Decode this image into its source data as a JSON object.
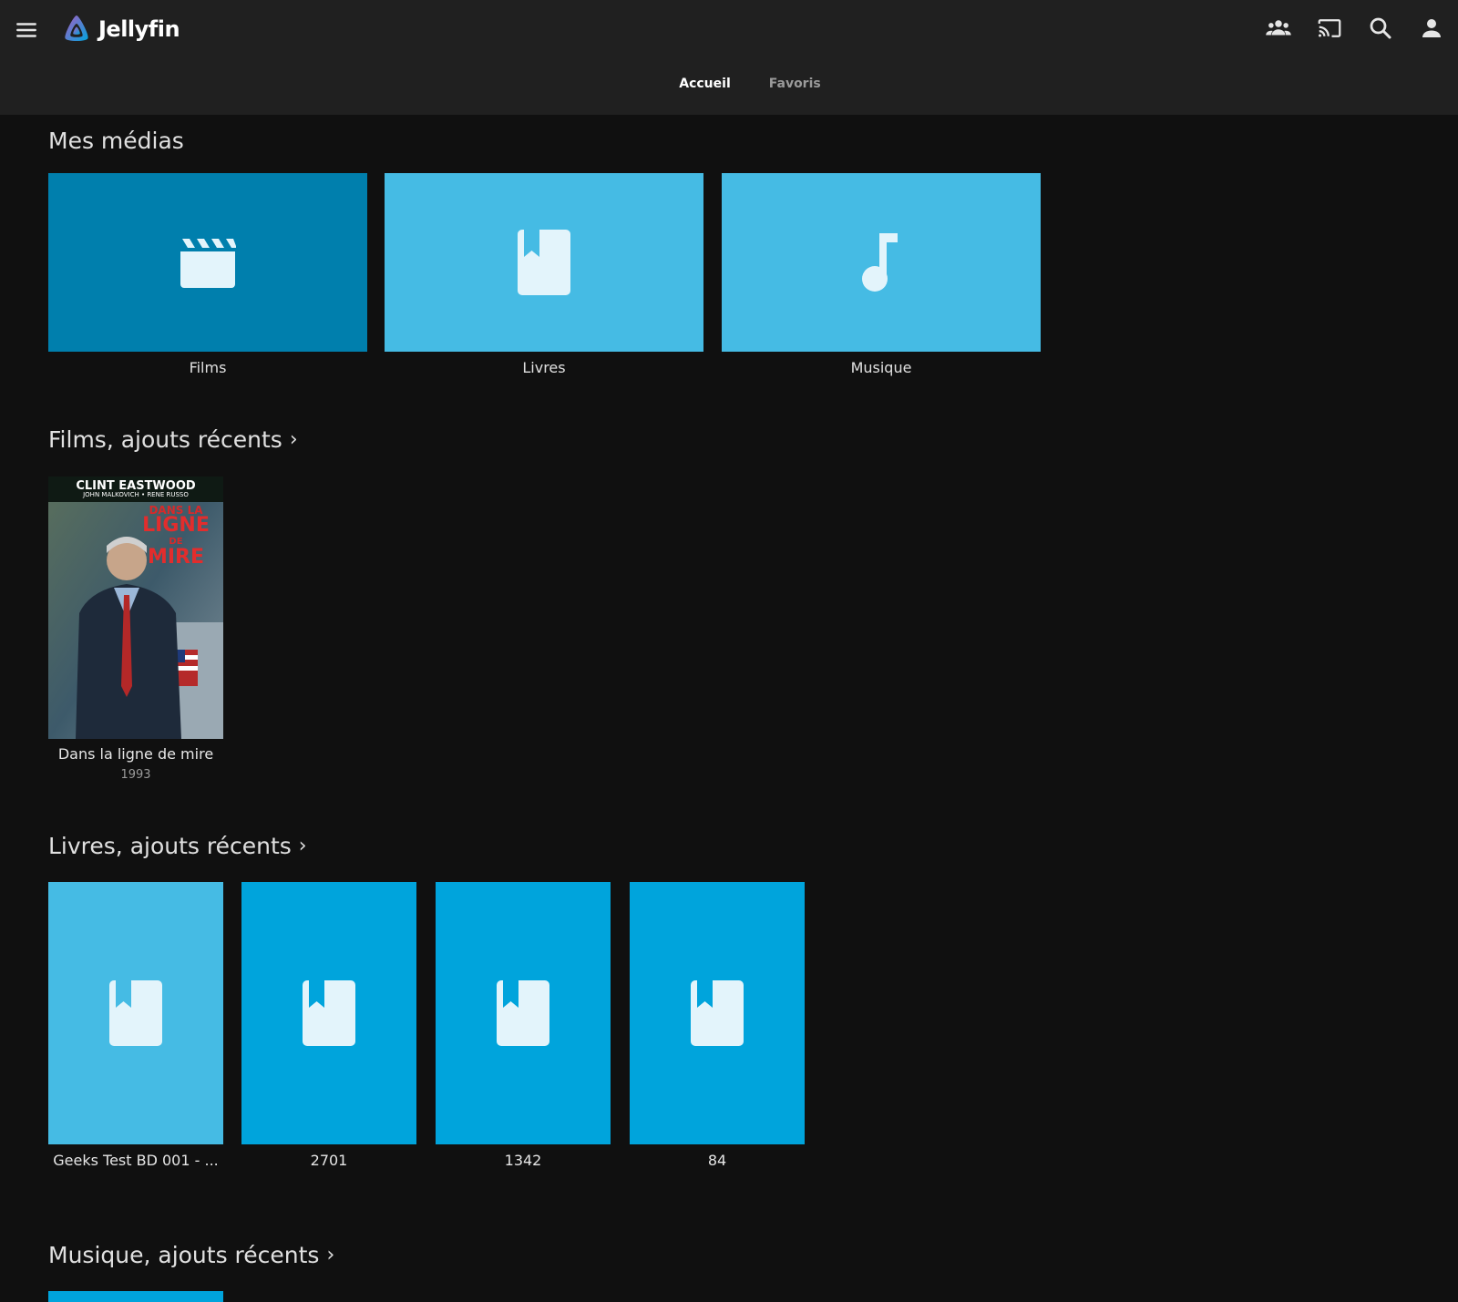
{
  "app": {
    "name": "Jellyfin"
  },
  "header": {
    "icons": [
      "menu-icon",
      "users-icon",
      "cast-icon",
      "search-icon",
      "user-icon"
    ]
  },
  "tabs": [
    {
      "label": "Accueil",
      "active": true
    },
    {
      "label": "Favoris",
      "active": false
    }
  ],
  "my_media": {
    "title": "Mes médias",
    "libraries": [
      {
        "label": "Films",
        "icon": "clapperboard-icon",
        "color": "#007fad"
      },
      {
        "label": "Livres",
        "icon": "book-icon",
        "color": "#45bbe4"
      },
      {
        "label": "Musique",
        "icon": "music-note-icon",
        "color": "#45bbe4"
      }
    ]
  },
  "films_recent": {
    "title": "Films, ajouts récents",
    "items": [
      {
        "title": "Dans la ligne de mire",
        "year": "1993",
        "poster_text": {
          "actor": "CLINT EASTWOOD",
          "costars": "JOHN MALKOVICH • RENE RUSSO",
          "title_line1": "DANS LA",
          "title_line2": "LIGNE",
          "title_line3": "DE",
          "title_line4": "MIRE"
        }
      }
    ]
  },
  "books_recent": {
    "title": "Livres, ajouts récents",
    "items": [
      {
        "label": "Geeks Test BD 001 - ...",
        "color": "#45bbe4"
      },
      {
        "label": "2701",
        "color": "#00a4dc"
      },
      {
        "label": "1342",
        "color": "#00a4dc"
      },
      {
        "label": "84",
        "color": "#00a4dc"
      }
    ]
  },
  "music_recent": {
    "title": "Musique, ajouts récents"
  },
  "colors": {
    "header_bg": "#202020",
    "page_bg": "#101010",
    "accent": "#00a4dc"
  }
}
